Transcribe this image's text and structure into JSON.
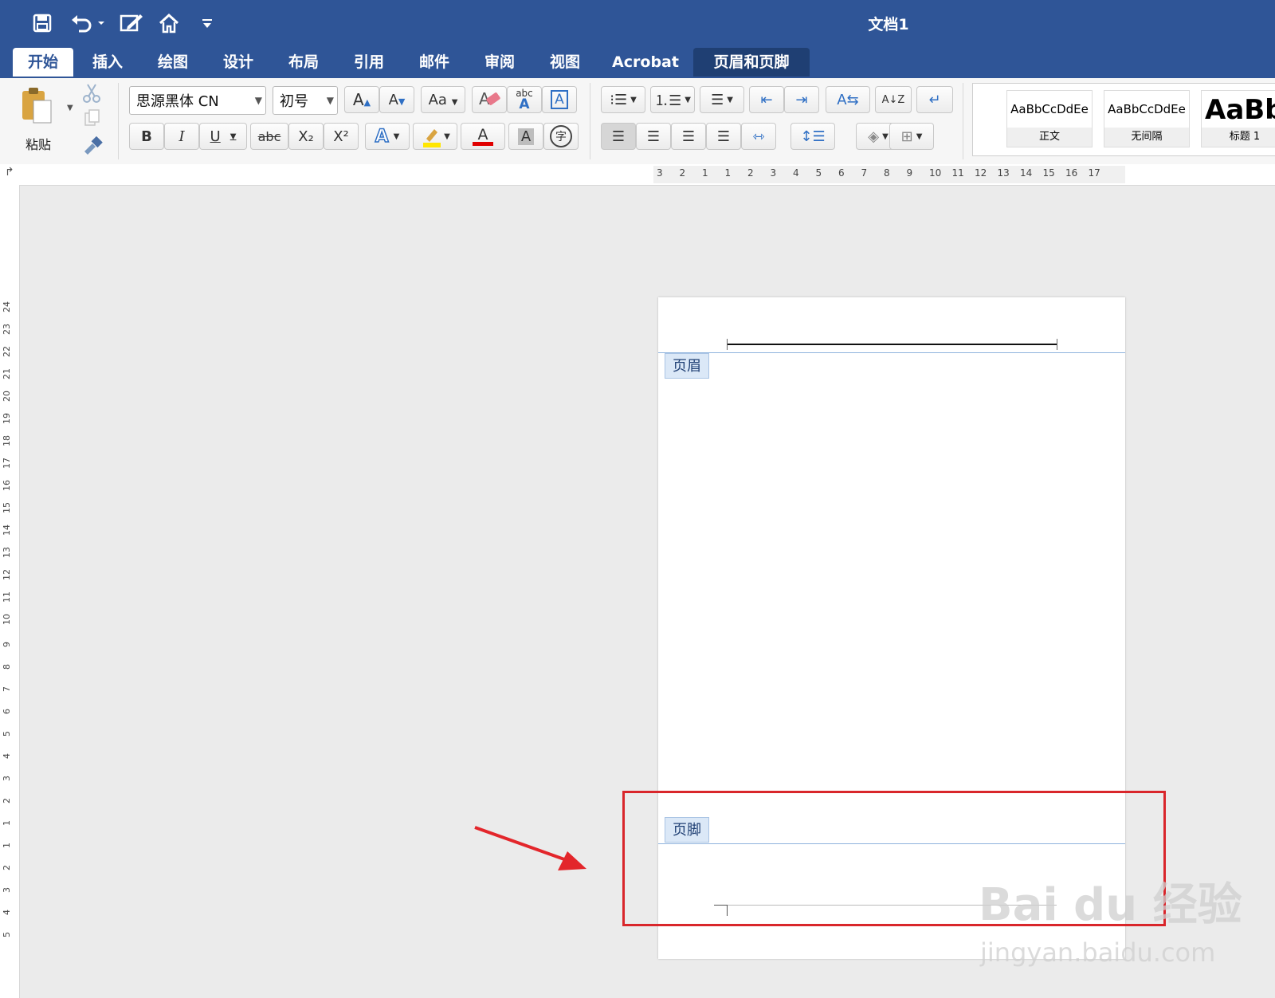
{
  "titlebar": {
    "document_title": "文档1",
    "qat_icons": [
      "save-icon",
      "undo-icon",
      "edit-document-icon",
      "home-icon",
      "customize-icon"
    ]
  },
  "tabs": [
    {
      "label": "开始",
      "active": true
    },
    {
      "label": "插入"
    },
    {
      "label": "绘图"
    },
    {
      "label": "设计"
    },
    {
      "label": "布局"
    },
    {
      "label": "引用"
    },
    {
      "label": "邮件"
    },
    {
      "label": "审阅"
    },
    {
      "label": "视图"
    },
    {
      "label": "Acrobat"
    },
    {
      "label": "页眉和页脚",
      "contextual": true
    }
  ],
  "clipboard": {
    "paste_label": "粘贴"
  },
  "font": {
    "family": "思源黑体 CN",
    "size": "初号",
    "bold": "B",
    "italic": "I",
    "underline": "U",
    "strikethrough": "abc",
    "subscript": "X₂",
    "superscript": "X²",
    "phonetic": "abc",
    "enclose": "字",
    "text_effect": "A",
    "font_color": "A",
    "shading": "A",
    "char_border": "A"
  },
  "styles": [
    {
      "sample": "AaBbCcDdEe",
      "name": "正文"
    },
    {
      "sample": "AaBbCcDdEe",
      "name": "无间隔"
    },
    {
      "sample": "AaBb",
      "name": "标题 1"
    }
  ],
  "ruler": {
    "horizontal": [
      "3",
      "2",
      "1",
      "1",
      "2",
      "3",
      "4",
      "5",
      "6",
      "7",
      "8",
      "9",
      "10",
      "11",
      "12",
      "13",
      "14",
      "15",
      "16",
      "17"
    ],
    "vertical": [
      "24",
      "23",
      "22",
      "21",
      "20",
      "19",
      "18",
      "17",
      "16",
      "15",
      "14",
      "13",
      "12",
      "11",
      "10",
      "9",
      "8",
      "7",
      "6",
      "5",
      "4",
      "3",
      "2",
      "1",
      "1",
      "2",
      "3",
      "4",
      "5"
    ]
  },
  "page": {
    "header_label": "页眉",
    "footer_label": "页脚"
  },
  "watermark": {
    "main": "Bai du 经验",
    "url": "jingyan.baidu.com"
  },
  "colors": {
    "accent": "#2f5597",
    "highlight_box": "#d9262b",
    "arrow": "#e3262b"
  }
}
